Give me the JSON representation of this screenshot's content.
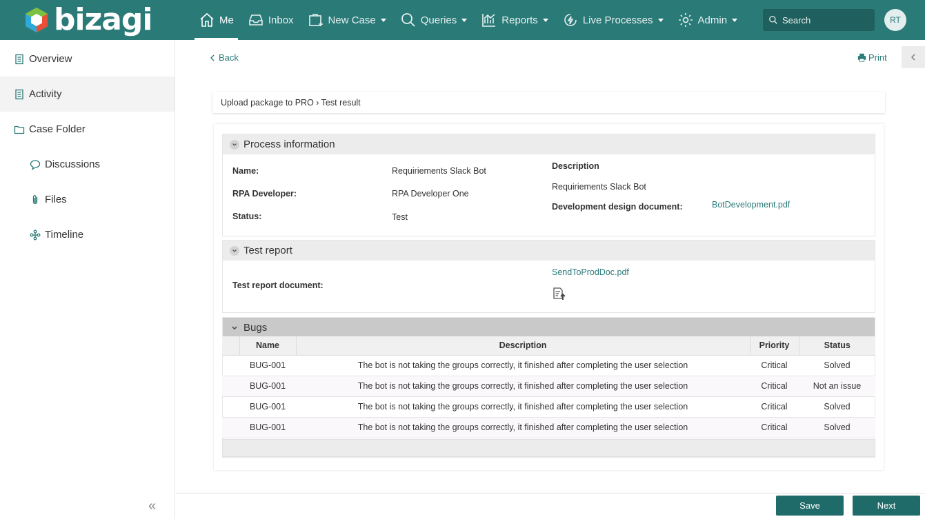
{
  "header": {
    "logo_text": "bizagi",
    "nav": [
      {
        "label": "Me",
        "icon": "home-icon"
      },
      {
        "label": "Inbox",
        "icon": "inbox-icon"
      },
      {
        "label": "New Case",
        "icon": "new-case-icon"
      },
      {
        "label": "Queries",
        "icon": "search-icon"
      },
      {
        "label": "Reports",
        "icon": "chart-icon"
      },
      {
        "label": "Live Processes",
        "icon": "lightning-icon"
      },
      {
        "label": "Admin",
        "icon": "gear-icon"
      }
    ],
    "search_placeholder": "Search",
    "avatar_initials": "RT"
  },
  "sidebar": {
    "items": [
      {
        "label": "Overview",
        "icon": "document-icon"
      },
      {
        "label": "Activity",
        "icon": "document-icon"
      },
      {
        "label": "Case Folder",
        "icon": "folder-icon"
      },
      {
        "label": "Discussions",
        "icon": "chat-icon"
      },
      {
        "label": "Files",
        "icon": "paperclip-icon"
      },
      {
        "label": "Timeline",
        "icon": "timeline-icon"
      }
    ],
    "collapse_glyph": "«"
  },
  "main": {
    "back_label": "Back",
    "print_label": "Print",
    "breadcrumb": "Upload package to PRO › Test result",
    "process_information": {
      "title": "Process information",
      "name_label": "Name:",
      "name_value": "Requiriements Slack Bot",
      "developer_label": "RPA Developer:",
      "developer_value": "RPA Developer One",
      "status_label": "Status:",
      "status_value": "Test",
      "description_label": "Description",
      "description_value": "Requiriements Slack Bot",
      "design_doc_label": "Development design document:",
      "design_doc_link": "BotDevelopment.pdf"
    },
    "test_report": {
      "title": "Test report",
      "doc_label": "Test report document:",
      "doc_link": "SendToProdDoc.pdf"
    },
    "bugs": {
      "title": "Bugs",
      "columns": [
        "Name",
        "Description",
        "Priority",
        "Status"
      ],
      "rows": [
        [
          "BUG-001",
          "The bot is not taking the groups correctly, it finished after completing the user selection",
          "Critical",
          "Solved"
        ],
        [
          "BUG-001",
          "The bot is not taking the groups correctly, it finished after completing the user selection",
          "Critical",
          "Not an issue"
        ],
        [
          "BUG-001",
          "The bot is not taking the groups correctly, it finished after completing the user selection",
          "Critical",
          "Solved"
        ],
        [
          "BUG-001",
          "The bot is not taking the groups correctly, it finished after completing the user selection",
          "Critical",
          "Solved"
        ]
      ]
    }
  },
  "footer": {
    "save_label": "Save",
    "next_label": "Next"
  },
  "colors": {
    "brand": "#2a7a78",
    "button": "#1f6b69"
  }
}
